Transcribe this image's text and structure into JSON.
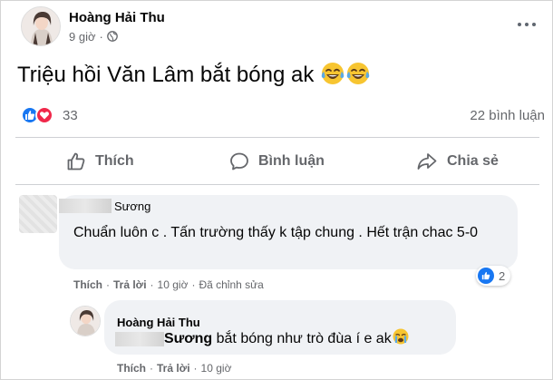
{
  "post": {
    "author": "Hoàng Hải Thu",
    "time": "9 giờ",
    "text": "Triệu hồi Văn Lâm bắt bóng ak",
    "reaction_count": "33",
    "comment_count": "22 bình luận",
    "icons": [
      "globe-icon",
      "more-icon",
      "grinning-tears-emoji",
      "like-icon",
      "love-icon"
    ]
  },
  "actions": {
    "like": "Thích",
    "comment": "Bình luận",
    "share": "Chia sẻ"
  },
  "comments": [
    {
      "name": "Sương",
      "text": "Chuẩn luôn c . Tấn trường thấy k tập chung . Hết trận chac 5-0",
      "like_label": "Thích",
      "reply_label": "Trả lời",
      "time": "10 giờ",
      "edited": "Đã chỉnh sửa",
      "reaction_count": "2"
    },
    {
      "name": "Hoàng Hải Thu",
      "mention": "Sương",
      "text": " bắt bóng như trò đùa í e ak",
      "like_label": "Thích",
      "reply_label": "Trả lời",
      "time": "10 giờ"
    }
  ],
  "colors": {
    "like_blue": "#1877f2",
    "love_red": "#f0284a",
    "secondary_text": "#65676b",
    "bubble_bg": "#f0f2f5"
  }
}
